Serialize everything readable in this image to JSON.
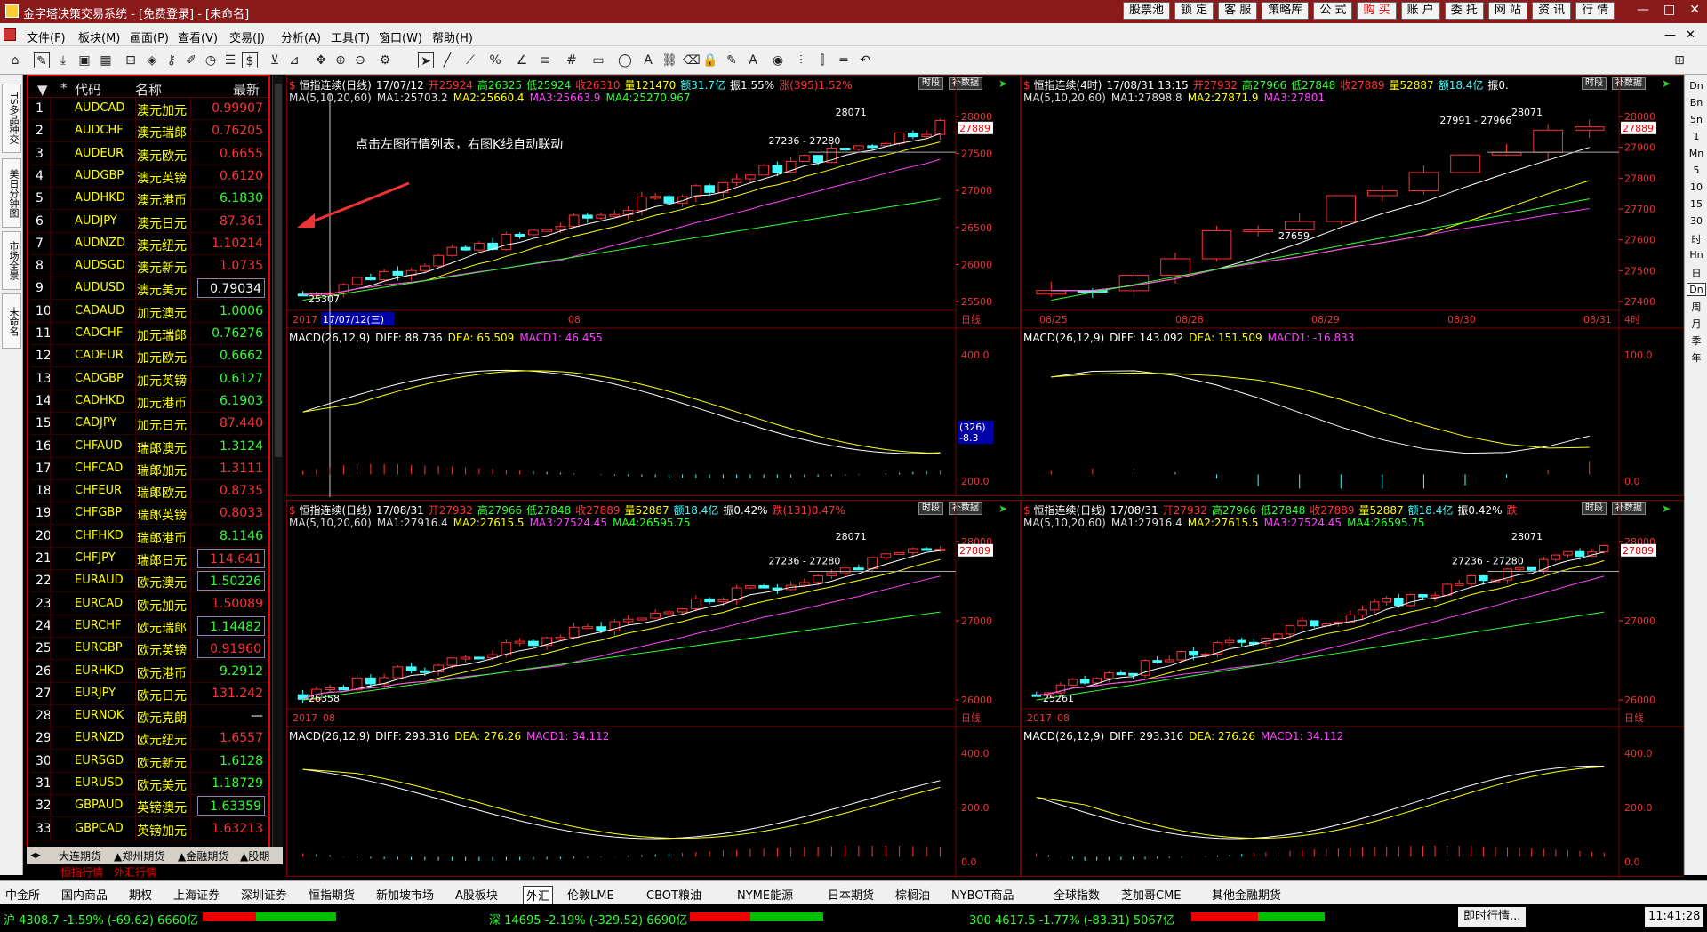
{
  "window": {
    "title": "金字塔决策交易系统 - [免费登录] - [未命名]",
    "controls": [
      "—",
      "□",
      "✕"
    ]
  },
  "topbar_buttons": [
    {
      "label": "股票池",
      "hot": false
    },
    {
      "label": "锁 定",
      "hot": false
    },
    {
      "label": "客 服",
      "hot": false
    },
    {
      "label": "策略库",
      "hot": false
    },
    {
      "label": "公 式",
      "hot": false
    },
    {
      "label": "购 买",
      "hot": true
    },
    {
      "label": "账 户",
      "hot": false
    },
    {
      "label": "委 托",
      "hot": false
    },
    {
      "label": "网 站",
      "hot": false
    },
    {
      "label": "资 讯",
      "hot": false
    },
    {
      "label": "行 情",
      "hot": false
    }
  ],
  "menu": [
    "文件(F)",
    "板块(M)",
    "画面(P)",
    "查看(V)",
    "交易(J)",
    "分析(A)",
    "工具(T)",
    "窗口(W)",
    "帮助(H)"
  ],
  "vtabs": [
    "TS多品种交",
    "美日分钟图",
    "市场全景",
    "未命名"
  ],
  "watchlist": {
    "headers": {
      "star": "*",
      "code": "代码",
      "name": "名称",
      "last": "最新"
    },
    "rows": [
      {
        "n": "1",
        "code": "AUDCAD",
        "name": "澳元加元",
        "price": "0.99907",
        "color": "#ff3333",
        "box": false
      },
      {
        "n": "2",
        "code": "AUDCHF",
        "name": "澳元瑞郎",
        "price": "0.76205",
        "color": "#ff3333",
        "box": false
      },
      {
        "n": "3",
        "code": "AUDEUR",
        "name": "澳元欧元",
        "price": "0.6655",
        "color": "#ff3333",
        "box": false
      },
      {
        "n": "4",
        "code": "AUDGBP",
        "name": "澳元英镑",
        "price": "0.6120",
        "color": "#ff3333",
        "box": false
      },
      {
        "n": "5",
        "code": "AUDHKD",
        "name": "澳元港币",
        "price": "6.1830",
        "color": "#33ff33",
        "box": false
      },
      {
        "n": "6",
        "code": "AUDJPY",
        "name": "澳元日元",
        "price": "87.361",
        "color": "#ff3333",
        "box": false
      },
      {
        "n": "7",
        "code": "AUDNZD",
        "name": "澳元纽元",
        "price": "1.10214",
        "color": "#ff3333",
        "box": false
      },
      {
        "n": "8",
        "code": "AUDSGD",
        "name": "澳元新元",
        "price": "1.0735",
        "color": "#ff3333",
        "box": false
      },
      {
        "n": "9",
        "code": "AUDUSD",
        "name": "澳元美元",
        "price": "0.79034",
        "color": "#ffffff",
        "box": true
      },
      {
        "n": "10",
        "code": "CADAUD",
        "name": "加元澳元",
        "price": "1.0006",
        "color": "#33ff33",
        "box": false
      },
      {
        "n": "11",
        "code": "CADCHF",
        "name": "加元瑞郎",
        "price": "0.76276",
        "color": "#33ff33",
        "box": false
      },
      {
        "n": "12",
        "code": "CADEUR",
        "name": "加元欧元",
        "price": "0.6662",
        "color": "#33ff33",
        "box": false
      },
      {
        "n": "13",
        "code": "CADGBP",
        "name": "加元英镑",
        "price": "0.6127",
        "color": "#33ff33",
        "box": false
      },
      {
        "n": "14",
        "code": "CADHKD",
        "name": "加元港币",
        "price": "6.1903",
        "color": "#33ff33",
        "box": false
      },
      {
        "n": "15",
        "code": "CADJPY",
        "name": "加元日元",
        "price": "87.440",
        "color": "#ff3333",
        "box": false
      },
      {
        "n": "16",
        "code": "CHFAUD",
        "name": "瑞郎澳元",
        "price": "1.3124",
        "color": "#33ff33",
        "box": false
      },
      {
        "n": "17",
        "code": "CHFCAD",
        "name": "瑞郎加元",
        "price": "1.3111",
        "color": "#ff3333",
        "box": false
      },
      {
        "n": "18",
        "code": "CHFEUR",
        "name": "瑞郎欧元",
        "price": "0.8735",
        "color": "#ff3333",
        "box": false
      },
      {
        "n": "19",
        "code": "CHFGBP",
        "name": "瑞郎英镑",
        "price": "0.8033",
        "color": "#ff3333",
        "box": false
      },
      {
        "n": "20",
        "code": "CHFHKD",
        "name": "瑞郎港币",
        "price": "8.1146",
        "color": "#33ff33",
        "box": false
      },
      {
        "n": "21",
        "code": "CHFJPY",
        "name": "瑞郎日元",
        "price": "114.641",
        "color": "#ff3333",
        "box": true
      },
      {
        "n": "22",
        "code": "EURAUD",
        "name": "欧元澳元",
        "price": "1.50226",
        "color": "#33ff33",
        "box": true
      },
      {
        "n": "23",
        "code": "EURCAD",
        "name": "欧元加元",
        "price": "1.50089",
        "color": "#ff3333",
        "box": false
      },
      {
        "n": "24",
        "code": "EURCHF",
        "name": "欧元瑞郎",
        "price": "1.14482",
        "color": "#33ff33",
        "box": true
      },
      {
        "n": "25",
        "code": "EURGBP",
        "name": "欧元英镑",
        "price": "0.91960",
        "color": "#ff3333",
        "box": true
      },
      {
        "n": "26",
        "code": "EURHKD",
        "name": "欧元港币",
        "price": "9.2912",
        "color": "#33ff33",
        "box": false
      },
      {
        "n": "27",
        "code": "EURJPY",
        "name": "欧元日元",
        "price": "131.242",
        "color": "#ff3333",
        "box": false
      },
      {
        "n": "28",
        "code": "EURNOK",
        "name": "欧元克朗",
        "price": "—",
        "color": "#ffffff",
        "box": false
      },
      {
        "n": "29",
        "code": "EURNZD",
        "name": "欧元纽元",
        "price": "1.6557",
        "color": "#ff3333",
        "box": false
      },
      {
        "n": "30",
        "code": "EURSGD",
        "name": "欧元新元",
        "price": "1.6128",
        "color": "#33ff33",
        "box": false
      },
      {
        "n": "31",
        "code": "EURUSD",
        "name": "欧元美元",
        "price": "1.18729",
        "color": "#33ff33",
        "box": false
      },
      {
        "n": "32",
        "code": "GBPAUD",
        "name": "英镑澳元",
        "price": "1.63359",
        "color": "#33ff33",
        "box": true
      },
      {
        "n": "33",
        "code": "GBPCAD",
        "name": "英镑加元",
        "price": "1.63213",
        "color": "#ff3333",
        "box": false
      }
    ],
    "tabs": [
      "大连期货",
      "▲郑州期货",
      "▲金融期货",
      "▲股期"
    ],
    "subtabs": [
      "恒指行情",
      "外汇行情"
    ]
  },
  "annotation": "点击左图行情列表，右图K线自动联动",
  "panels": [
    {
      "id": "tl",
      "header": {
        "title": "恒指连续(日线)",
        "date": "17/07/12",
        "open": "开25924",
        "high": "高26325",
        "low": "低25924",
        "close": "收26310",
        "vol": "量121470",
        "amt": "额31.7亿",
        "amp": "振1.55%",
        "chg": "涨(395)1.52%"
      },
      "ma": {
        "label": "MA(5,10,20,60)",
        "ma1": "MA1:25703.2",
        "ma2": "MA2:25660.4",
        "ma3": "MA3:25663.9",
        "ma4": "MA4:25270.967"
      },
      "btn1": "时段",
      "btn2": "补数据",
      "yticks": [
        "28000",
        "27500",
        "27000",
        "26500",
        "26000",
        "25500"
      ],
      "price_tag": "27889",
      "marks": {
        "high": "28071",
        "low": "25307",
        "range": "27236 - 27280"
      },
      "xaxis": {
        "a": "2017",
        "b": "17/07/12(三)",
        "c": "08",
        "period": "日线"
      },
      "macd": {
        "label": "MACD(26,12,9)",
        "diff": "DIFF: 88.736",
        "dea": "DEA: 65.509",
        "macd": "MACD1: 46.455",
        "ticks": [
          "400.0",
          "200.0"
        ],
        "tag1": "(326)",
        "tag2": "-8.3"
      }
    },
    {
      "id": "tr",
      "header": {
        "title": "恒指连续(4时)",
        "date": "17/08/31 13:15",
        "open": "开27932",
        "high": "高27966",
        "low": "低27848",
        "close": "收27889",
        "vol": "量52887",
        "amt": "额18.4亿",
        "amp": "振0.",
        "chg": ""
      },
      "ma": {
        "label": "MA(5,10,20,60)",
        "ma1": "MA1:27898.8",
        "ma2": "MA2:27871.9",
        "ma3": "MA3:27801",
        "ma4": ""
      },
      "btn1": "时段",
      "btn2": "补数据",
      "yticks": [
        "28000",
        "27900",
        "27800",
        "27700",
        "27600",
        "27500",
        "27400"
      ],
      "price_tag": "27889",
      "marks": {
        "high": "28071",
        "low": "27659",
        "range": "27991 - 27966"
      },
      "xaxis": {
        "a": "08/25",
        "b": "08/28",
        "c": "08/29",
        "d": "08/30",
        "e": "08/31",
        "period": "4时"
      },
      "macd": {
        "label": "MACD(26,12,9)",
        "diff": "DIFF: 143.092",
        "dea": "DEA: 151.509",
        "macd": "MACD1: -16.833",
        "ticks": [
          "100.0",
          "0.0"
        ]
      }
    },
    {
      "id": "bl",
      "header": {
        "title": "恒指连续(日线)",
        "date": "17/08/31",
        "open": "开27932",
        "high": "高27966",
        "low": "低27848",
        "close": "收27889",
        "vol": "量52887",
        "amt": "额18.4亿",
        "amp": "振0.42%",
        "chg": "跌(131)0.47%"
      },
      "ma": {
        "label": "MA(5,10,20,60)",
        "ma1": "MA1:27916.4",
        "ma2": "MA2:27615.5",
        "ma3": "MA3:27524.45",
        "ma4": "MA4:26595.75"
      },
      "btn1": "时段",
      "btn2": "补数据",
      "yticks": [
        "28000",
        "27000",
        "26000"
      ],
      "price_tag": "27889",
      "marks": {
        "high": "28071",
        "low": "26358",
        "range": "27236 - 27280"
      },
      "xaxis": {
        "a": "2017",
        "b": "",
        "c": "08",
        "period": "日线"
      },
      "macd": {
        "label": "MACD(26,12,9)",
        "diff": "DIFF: 293.316",
        "dea": "DEA: 276.26",
        "macd": "MACD1: 34.112",
        "ticks": [
          "400.0",
          "200.0",
          "0.0"
        ]
      }
    },
    {
      "id": "br",
      "header": {
        "title": "恒指连续(日线)",
        "date": "17/08/31",
        "open": "开27932",
        "high": "高27966",
        "low": "低27848",
        "close": "收27889",
        "vol": "量52887",
        "amt": "额18.4亿",
        "amp": "振0.42%",
        "chg": "跌"
      },
      "ma": {
        "label": "MA(5,10,20,60)",
        "ma1": "MA1:27916.4",
        "ma2": "MA2:27615.5",
        "ma3": "MA3:27524.45",
        "ma4": "MA4:26595.75"
      },
      "btn1": "时段",
      "btn2": "补数据",
      "yticks": [
        "28000",
        "27000",
        "26000"
      ],
      "price_tag": "27889",
      "marks": {
        "high": "28071",
        "low": "25261",
        "range": "27236 - 27280"
      },
      "xaxis": {
        "a": "2017",
        "b": "",
        "c": "08",
        "period": "日线"
      },
      "macd": {
        "label": "MACD(26,12,9)",
        "diff": "DIFF: 293.316",
        "dea": "DEA: 276.26",
        "macd": "MACD1: 34.112",
        "ticks": [
          "400.0",
          "200.0",
          "0.0"
        ]
      }
    }
  ],
  "right_toolbar": [
    "Dn",
    "Bn",
    "5n",
    "1",
    "Mn",
    "5",
    "10",
    "15",
    "30",
    "时",
    "Hn",
    "日",
    "Dn",
    "周",
    "月",
    "季",
    "年"
  ],
  "bottom_tabs": [
    "中金所",
    "国内商品",
    "期权",
    "上海证券",
    "深圳证券",
    "恒指期货",
    "新加坡市场",
    "A股板块",
    "外汇",
    "伦敦LME",
    "CBOT粮油",
    "NYME能源",
    "日本期货",
    "棕榈油",
    "NYBOT商品",
    "全球指数",
    "芝加哥CME",
    "其他金融期货"
  ],
  "status": {
    "sh": "沪 4308.7 -1.59% (-69.62) 6660亿",
    "sz": "深 14695 -2.19% (-329.52) 6690亿",
    "i300": "300 4617.5 -1.77% (-83.31) 5067亿",
    "live": "即时行情...",
    "time": "11:41:28"
  }
}
